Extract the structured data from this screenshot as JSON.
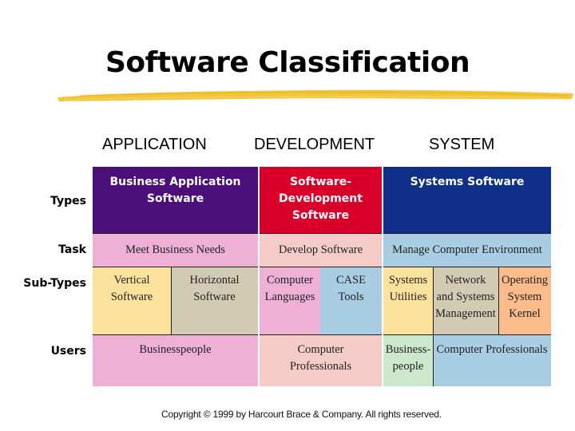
{
  "title": "Software Classification",
  "column_headings": [
    "APPLICATION",
    "DEVELOPMENT",
    "SYSTEM"
  ],
  "row_labels": {
    "types": "Types",
    "task": "Task",
    "subtypes": "Sub-Types",
    "users": "Users"
  },
  "colors": {
    "accent_brush": "#f2c230",
    "application_header": "#4b0f7a",
    "development_header": "#d8002a",
    "system_header": "#0f2f88",
    "pink": "#efb0d6",
    "salmon": "#f5cbc8",
    "light_blue": "#a9cde3",
    "yellow": "#fbe29c",
    "tan": "#d1cbb3",
    "orange": "#fbbb8a",
    "light_green": "#cbe8cd"
  },
  "grid": {
    "application": {
      "type": "Business Application Software",
      "type_lines": [
        "Business Application",
        "Software"
      ],
      "task": "Meet Business Needs",
      "subtypes": [
        {
          "lines": [
            "Vertical",
            "Software"
          ]
        },
        {
          "lines": [
            "Horizontal",
            "Software"
          ]
        }
      ],
      "users": "Businesspeople"
    },
    "development": {
      "type": "Software-Development Software",
      "type_lines": [
        "Software-",
        "Development",
        "Software"
      ],
      "task": "Develop Software",
      "subtypes": [
        {
          "lines": [
            "Computer",
            "Languages"
          ]
        },
        {
          "lines": [
            "CASE",
            "Tools"
          ]
        }
      ],
      "users_lines": [
        "Computer",
        "Professionals"
      ]
    },
    "system": {
      "type": "Systems Software",
      "task": "Manage Computer Environment",
      "subtypes": [
        {
          "lines": [
            "Systems",
            "Utilities"
          ]
        },
        {
          "lines": [
            "Network",
            "and Systems",
            "Management"
          ]
        },
        {
          "lines": [
            "Operating",
            "System",
            "Kernel"
          ]
        }
      ],
      "users": [
        {
          "lines": [
            "Business-",
            "people"
          ]
        },
        {
          "lines": [
            "Computer Professionals"
          ]
        }
      ]
    }
  },
  "copyright": "Copyright © 1999 by Harcourt Brace & Company. All rights reserved."
}
